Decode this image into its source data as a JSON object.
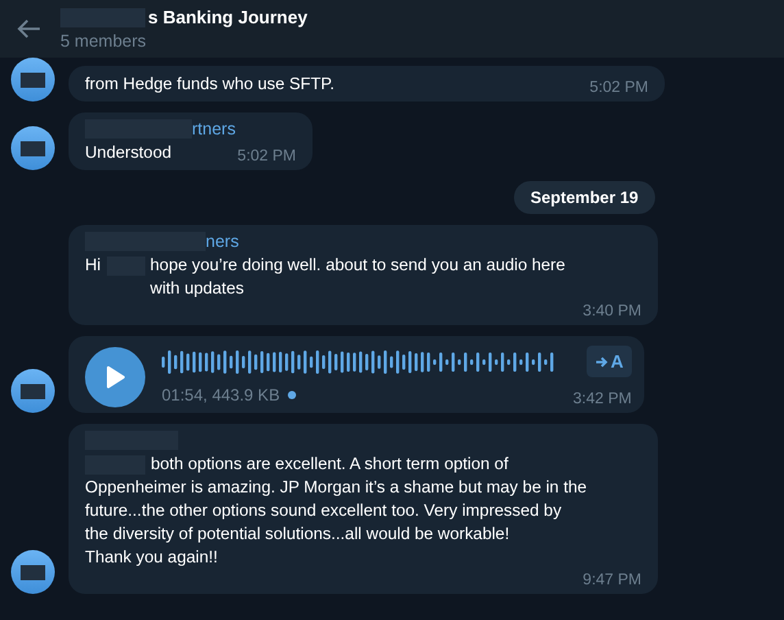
{
  "header": {
    "title": "s Banking Journey",
    "subtitle": "5 members"
  },
  "messages": [
    {
      "kind": "text",
      "text": "from Hedge funds who use SFTP.",
      "time": "5:02 PM",
      "avatar": true,
      "inline_time": true
    },
    {
      "kind": "text",
      "sender": "rtners",
      "text": "Understood",
      "time": "5:02 PM",
      "avatar": true,
      "inline_time": true
    },
    {
      "kind": "date",
      "text": "September 19"
    },
    {
      "kind": "text",
      "sender": "ners",
      "greeting": "Hi",
      "text": "hope you’re doing well. about to send you an audio here\nwith updates",
      "time": "3:40 PM",
      "avatar": false
    },
    {
      "kind": "audio",
      "meta": "01:54, 443.9 KB",
      "unplayed": true,
      "transcribe": "A",
      "time": "3:42 PM",
      "avatar": true
    },
    {
      "kind": "text",
      "sender_redacted": true,
      "redacted_start": true,
      "text": "both options are excellent. A short term option of\nOppenheimer is amazing. JP Morgan it’s a shame but may be in the\nfuture...the other options sound excellent too. Very impressed by\nthe diversity of potential solutions...all would be workable!\nThank you again!!",
      "time": "9:47 PM",
      "avatar": true
    }
  ]
}
